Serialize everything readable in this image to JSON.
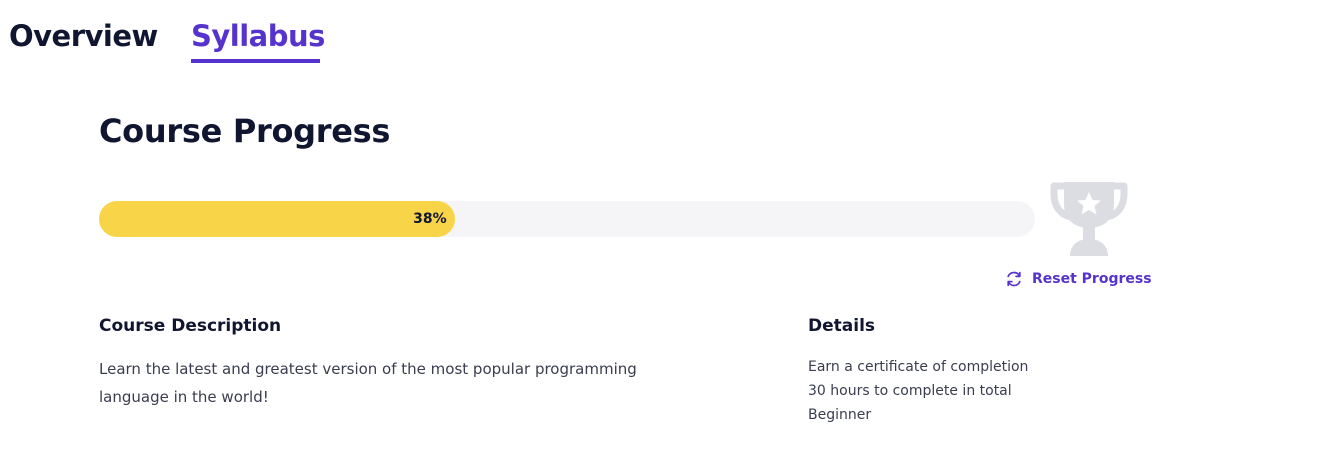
{
  "tabs": [
    {
      "label": "Overview",
      "active": false
    },
    {
      "label": "Syllabus",
      "active": true
    }
  ],
  "course_progress": {
    "title": "Course Progress",
    "percent": 38,
    "percent_label": "38%",
    "reset_label": "Reset Progress"
  },
  "icons": {
    "trophy": "trophy-icon",
    "reset": "refresh-icon"
  },
  "colors": {
    "accent": "#5533cc",
    "progress_fill": "#f8d449",
    "progress_track": "#f5f5f8",
    "trophy": "#dcdde2",
    "text_dark": "#10162f"
  },
  "description": {
    "heading": "Course Description",
    "text": "Learn the latest and greatest version of the most popular programming language in the world!"
  },
  "details": {
    "heading": "Details",
    "items": [
      "Earn a certificate of completion",
      "30 hours to complete in total",
      "Beginner"
    ]
  }
}
